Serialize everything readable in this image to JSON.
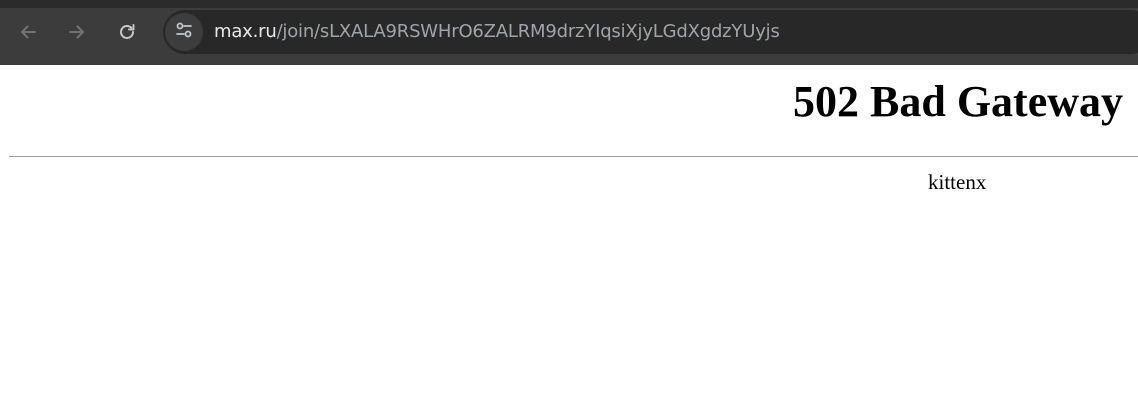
{
  "browser": {
    "back_icon": "arrow-left-icon",
    "forward_icon": "arrow-right-icon",
    "reload_icon": "reload-icon",
    "site_info_icon": "tune-icon",
    "address": {
      "host": "max.ru",
      "path": "/join/sLXALA9RSWHrO6ZALRM9drzYIqsiXjyLGdXgdzYUyjs"
    },
    "colors": {
      "toolbar": "#3c3c3c",
      "omnibox": "#282828",
      "icon": "#9aa0a6"
    }
  },
  "page": {
    "title": "502 Bad Gateway",
    "server": "kittenx"
  }
}
